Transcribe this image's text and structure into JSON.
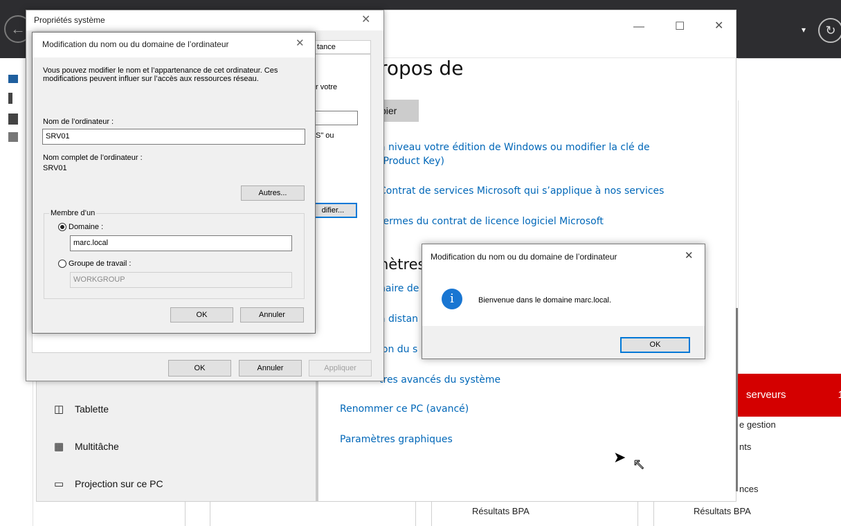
{
  "server_manager": {
    "right_panel": {
      "red_band_label": "serveurs",
      "red_band_count": "1",
      "line1": "e gestion",
      "line2": "nts",
      "line3": "nces"
    },
    "bpa_left": "Résultats BPA",
    "bpa_right": "Résultats BPA"
  },
  "settings": {
    "title": "ropos de",
    "copy_button": "pier",
    "links": [
      "à niveau votre édition de Windows ou modifier la clé de",
      "(Product Key)",
      "Contrat de services Microsoft qui s’applique à nos services",
      "termes du contrat de licence logiciel Microsoft"
    ],
    "section_heading": "nètres",
    "section_links": [
      "naire de",
      "à distan",
      "ion du s",
      "tres avancés du système",
      "Renommer ce PC (avancé)",
      "Paramètres graphiques"
    ],
    "nav": [
      {
        "icon": "tablet-icon",
        "label": "Tablette"
      },
      {
        "icon": "multitask-icon",
        "label": "Multitâche"
      },
      {
        "icon": "projection-icon",
        "label": "Projection sur ce PC"
      }
    ]
  },
  "system_properties": {
    "title": "Propriétés système",
    "tab_fragment": "tance",
    "text_fragment1": "r votre",
    "text_fragment2": "S\" ou",
    "modify_button_fragment": "difier...",
    "ok": "OK",
    "cancel": "Annuler",
    "apply": "Appliquer"
  },
  "rename_dialog": {
    "title": "Modification du nom ou du domaine de l’ordinateur",
    "description": "Vous pouvez modifier le nom et l’appartenance de cet ordinateur. Ces modifications peuvent influer sur l’accès aux ressources réseau.",
    "computer_name_label": "Nom de l’ordinateur :",
    "computer_name_value": "SRV01",
    "full_name_label": "Nom complet de l’ordinateur :",
    "full_name_value": "SRV01",
    "more_button": "Autres...",
    "member_of_label": "Membre d’un",
    "domain_label": "Domaine :",
    "domain_value": "marc.local",
    "workgroup_label": "Groupe de travail :",
    "workgroup_value": "WORKGROUP",
    "ok": "OK",
    "cancel": "Annuler"
  },
  "welcome_box": {
    "title": "Modification du nom ou du domaine de l’ordinateur",
    "message": "Bienvenue dans le domaine marc.local.",
    "ok": "OK"
  }
}
